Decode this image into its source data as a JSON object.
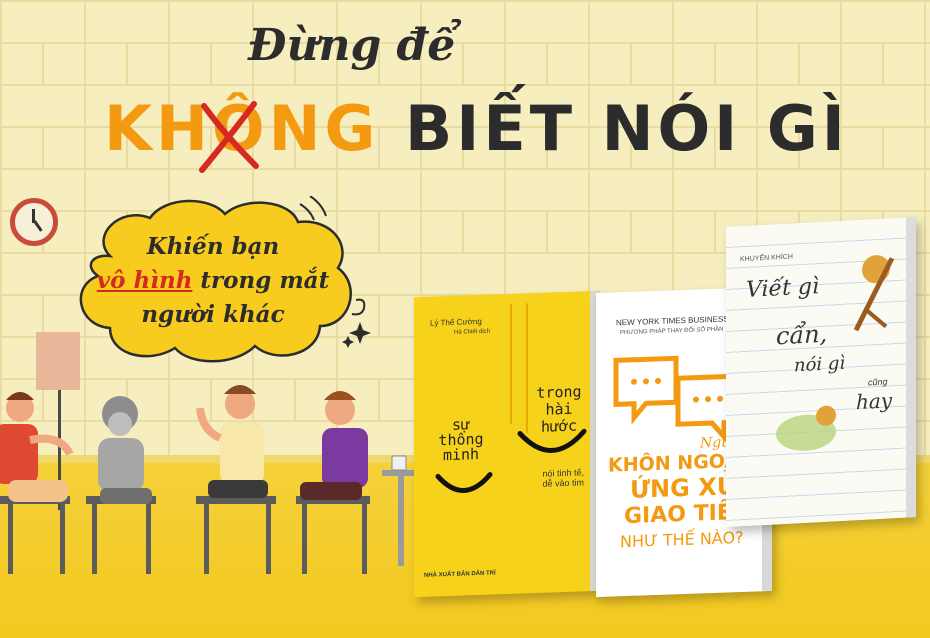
{
  "headline": {
    "line1": "Đừng để",
    "line2_part1": "KHÔNG",
    "line2_part2": "BIẾT NÓI GÌ"
  },
  "cloud": {
    "line1": "Khiến bạn",
    "line2_red": "vô hình",
    "line2_rest": " trong mắt",
    "line3": "người khác"
  },
  "books": {
    "yellow": {
      "author": "Lý Thế Cường",
      "translator": "Hà Chiết dịch",
      "left_words": [
        "sự",
        "thông",
        "minh"
      ],
      "right_words": [
        "trong",
        "hài",
        "hước"
      ],
      "tagline_1": "nói tinh tế,",
      "tagline_2": "dễ vào tim",
      "publisher": "NHÀ XUẤT BẢN DÂN TRÍ"
    },
    "white": {
      "bestseller": "NEW YORK TIMES BUSINESS BESTSELLER",
      "subhead": "PHƯƠNG PHÁP THAY ĐỔI SỐ PHẬN",
      "script_word": "Người",
      "title_1": "KHÔN NGOAN",
      "title_2": "ỨNG XỬ",
      "title_3": "GIAO TIẾP",
      "title_4": "NHƯ THẾ NÀO?"
    },
    "paper": {
      "author": "KHUYẾN KHÍCH",
      "line1": "Viết gì",
      "line2": "cẩn,",
      "line3": "nói gì",
      "line4": "cũng",
      "line5": "hay"
    }
  },
  "colors": {
    "accent_orange": "#f39a10",
    "accent_red": "#d6291f",
    "cloud_yellow": "#f7cc1e",
    "floor_yellow": "#f3c91f"
  }
}
